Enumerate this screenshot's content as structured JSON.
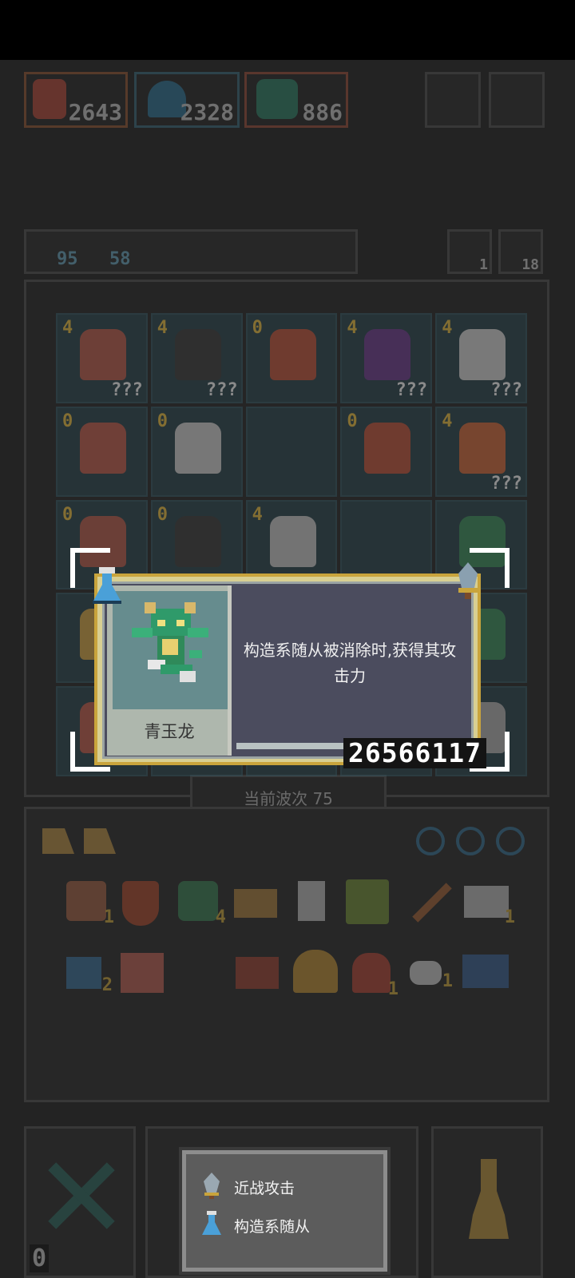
{
  "top_heroes": [
    {
      "value": "2643"
    },
    {
      "value": "2328"
    },
    {
      "value": "886"
    }
  ],
  "resource_counts": {
    "left_a": "95",
    "left_b": "58",
    "refresh": "1",
    "key": "18"
  },
  "grid": {
    "levels": [
      "4",
      "4",
      "0",
      "4",
      "4",
      "0",
      "0",
      "",
      "0",
      "4",
      "0",
      "0",
      "4",
      "",
      "",
      ""
    ],
    "unknown_label": "???"
  },
  "wave_label": "当前波次 75",
  "inventory_counts": [
    "1",
    "4",
    "1",
    "2",
    "1",
    "1"
  ],
  "bottom_left_count": "0",
  "card": {
    "name": "青玉龙",
    "description": "构造系随从被消除时,获得其攻击力",
    "score": "26566117",
    "type_icon": "flask-icon",
    "attack_icon": "sword-icon"
  },
  "tags": [
    {
      "label": "近战攻击",
      "icon": "sword-icon"
    },
    {
      "label": "构造系随从",
      "icon": "flask-icon"
    }
  ]
}
